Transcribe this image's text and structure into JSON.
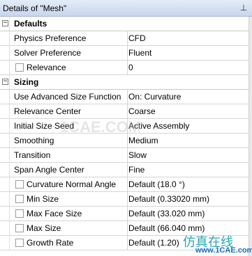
{
  "panel": {
    "title": "Details of \"Mesh\"",
    "pin_icon": "pin-icon"
  },
  "sections": [
    {
      "label": "Defaults",
      "toggle": "⊟",
      "rows": [
        {
          "name": "Physics Preference",
          "value": "CFD",
          "checkbox": false
        },
        {
          "name": "Solver Preference",
          "value": "Fluent",
          "checkbox": false
        },
        {
          "name": "Relevance",
          "value": "0",
          "checkbox": true
        }
      ]
    },
    {
      "label": "Sizing",
      "toggle": "⊟",
      "rows": [
        {
          "name": "Use Advanced Size Function",
          "value": "On: Curvature",
          "checkbox": false
        },
        {
          "name": "Relevance Center",
          "value": "Coarse",
          "checkbox": false
        },
        {
          "name": "Initial Size Seed",
          "value": "Active Assembly",
          "checkbox": false
        },
        {
          "name": "Smoothing",
          "value": "Medium",
          "checkbox": false
        },
        {
          "name": "Transition",
          "value": "Slow",
          "checkbox": false
        },
        {
          "name": "Span Angle Center",
          "value": "Fine",
          "checkbox": false
        },
        {
          "name": "Curvature Normal Angle",
          "value": "Default (18.0 °)",
          "checkbox": true
        },
        {
          "name": "Min Size",
          "value": "Default (0.33020 mm)",
          "checkbox": true
        },
        {
          "name": "Max Face Size",
          "value": "Default (33.020 mm)",
          "checkbox": true
        },
        {
          "name": "Max Size",
          "value": "Default (66.040 mm)",
          "checkbox": true
        },
        {
          "name": "Growth Rate",
          "value": "Default (1.20)",
          "checkbox": true
        }
      ]
    }
  ],
  "watermark": {
    "center_text": "1CAE.COM",
    "logo_text": "仿真在线",
    "url_text": "www.1CAE.com"
  }
}
